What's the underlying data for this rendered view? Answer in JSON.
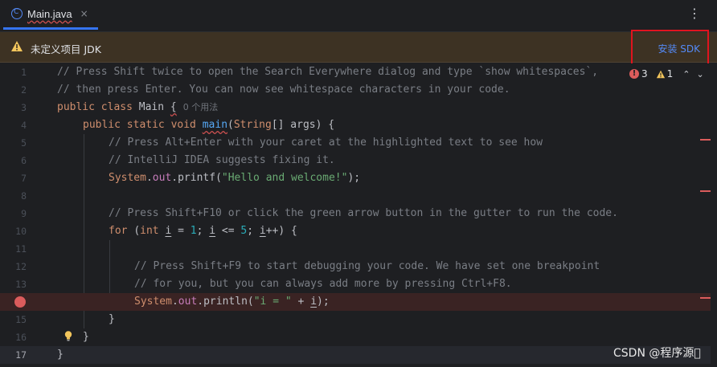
{
  "tab": {
    "label": "Main.java",
    "close": "×",
    "icon": "class-c-icon"
  },
  "toolbar": {
    "more": "⋮"
  },
  "banner": {
    "text": "未定义项目 JDK",
    "action": "安装 SDK"
  },
  "inspections": {
    "errors": "3",
    "warnings": "1",
    "up": "⌃",
    "down": "⌄"
  },
  "lines": [
    {
      "num": "1",
      "text": "// Press Shift twice to open the Search Everywhere dialog and type `show whitespaces`,"
    },
    {
      "num": "2",
      "text": "// then press Enter. You can now see whitespace characters in your code."
    },
    {
      "num": "3",
      "kw": "public class ",
      "name": "Main ",
      "brace": "{",
      "usages": "0 个用法"
    },
    {
      "num": "4",
      "kw": "public static void ",
      "fn": "main",
      "open": "(",
      "type": "String",
      "rest": "[] args) {"
    },
    {
      "num": "5",
      "text": "// Press Alt+Enter with your caret at the highlighted text to see how"
    },
    {
      "num": "6",
      "text": "// IntelliJ IDEA suggests fixing it."
    },
    {
      "num": "7",
      "sys": "System",
      "dot1": ".",
      "field": "out",
      "call": ".printf(",
      "str": "\"Hello and welcome!\"",
      "end": ");"
    },
    {
      "num": "8",
      "text": ""
    },
    {
      "num": "9",
      "text": "// Press Shift+F10 or click the green arrow button in the gutter to run the code."
    },
    {
      "num": "10",
      "kw1": "for ",
      "p1": "(",
      "kw2": "int ",
      "v1": "i",
      "eq": " = ",
      "n1": "1",
      "semi1": "; ",
      "v2": "i",
      "lt": " <= ",
      "n2": "5",
      "semi2": "; ",
      "v3": "i",
      "tail": "++) {"
    },
    {
      "num": "11",
      "text": ""
    },
    {
      "num": "12",
      "text": "// Press Shift+F9 to start debugging your code. We have set one breakpoint"
    },
    {
      "num": "13",
      "text": "// for you, but you can always add more by pressing Ctrl+F8."
    },
    {
      "num": "14",
      "sys": "System",
      "dot1": ".",
      "field": "out",
      "call": ".println(",
      "str": "\"i = \"",
      "plus": " + ",
      "var": "i",
      "end": ");"
    },
    {
      "num": "15",
      "text": "}"
    },
    {
      "num": "16",
      "text": "}"
    },
    {
      "num": "17",
      "text": "}"
    }
  ],
  "watermark": "CSDN @程序源\u0000"
}
